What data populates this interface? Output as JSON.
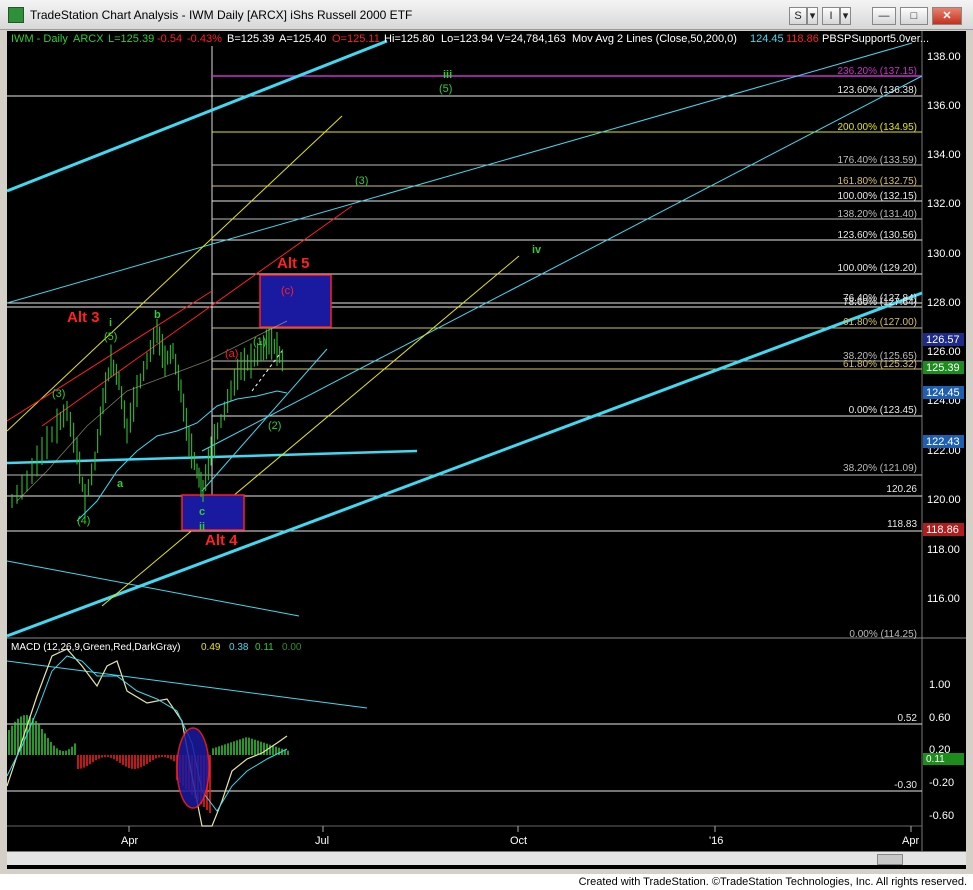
{
  "window": {
    "title": "TradeStation Chart Analysis - IWM Daily [ARCX] iShs Russell 2000 ETF",
    "buttons": {
      "s": "S",
      "menu": "▾",
      "toolbar": "I",
      "menu2": "▾",
      "minimize": "—",
      "restore": "□",
      "close": "✕"
    }
  },
  "info_bar": {
    "symbol": "IWM - Daily",
    "exchange": "ARCX",
    "last": "L=125.39",
    "change": "-0.54",
    "pct_change": "-0.43%",
    "bid": "B=125.39",
    "ask": "A=125.40",
    "open": "O=125.11",
    "high": "Hi=125.80",
    "low": "Lo=123.94",
    "volume": "V=24,784,163",
    "indicator": "Mov Avg 2 Lines (Close,50,200,0)",
    "ma50": "124.45",
    "ma200": "118.86",
    "study": "PBSPSupport5.0ver..."
  },
  "price_axis": {
    "ticks": [
      "138.00",
      "136.00",
      "134.00",
      "132.00",
      "130.00",
      "128.00",
      "126.00",
      "124.00",
      "122.00",
      "120.00",
      "118.00",
      "116.00"
    ],
    "badges": {
      "high_mark": "126.57",
      "last": "125.39",
      "ma50": "124.45",
      "support": "122.43",
      "ma200": "118.86"
    }
  },
  "fib_labels": [
    "236.20% (137.15)",
    "123.60% (136.38)",
    "200.00% (134.95)",
    "176.40% (133.59)",
    "161.80% (132.75)",
    "100.00% (132.15)",
    "138.20% (131.40)",
    "123.60% (130.56)",
    "100.00% (129.20)",
    "76.40% (127.84)",
    "78.60% (127.64)",
    "61.80% (127.00)",
    "38.20% (125.65)",
    "61.80% (125.32)",
    "0.00% (123.45)",
    "38.20% (121.09)",
    "120.26",
    "118.83",
    "0.00% (114.25)"
  ],
  "wave_labels": {
    "alt3": "Alt 3",
    "alt4": "Alt 4",
    "alt5": "Alt 5",
    "i": "i",
    "ii": "ii",
    "iii": "iii",
    "iv": "iv",
    "a": "a",
    "b": "b",
    "c": "c",
    "w3": "(3)",
    "w4": "(4)",
    "w5": "(5)",
    "w5_top": "(5)",
    "w3_top": "(3)",
    "a_red": "(a)",
    "c_red": "(c)",
    "w1": "(1)",
    "w2": "(2)"
  },
  "macd": {
    "label": "MACD (12,26,9,Green,Red,DarkGray)",
    "v1": "0.49",
    "v2": "0.38",
    "v3": "0.11",
    "v4": "0.00",
    "ticks": [
      "1.00",
      "0.60",
      "0.20",
      "-0.20",
      "-0.60"
    ],
    "levels": {
      "upper": "0.52",
      "lower": "-0.30"
    },
    "badge": "0.11"
  },
  "time_axis": {
    "labels": [
      "Apr",
      "Jul",
      "Oct",
      "'16",
      "Apr"
    ]
  },
  "colors": {
    "green": "#33cc33",
    "red": "#ff2020",
    "cyan": "#3fd9f2",
    "fib_gold": "#d4c06a",
    "fib_white": "#e8e8e8",
    "magenta": "#cc33cc"
  },
  "footer": {
    "text": "Created with TradeStation. ©TradeStation Technologies, Inc. All rights reserved."
  }
}
